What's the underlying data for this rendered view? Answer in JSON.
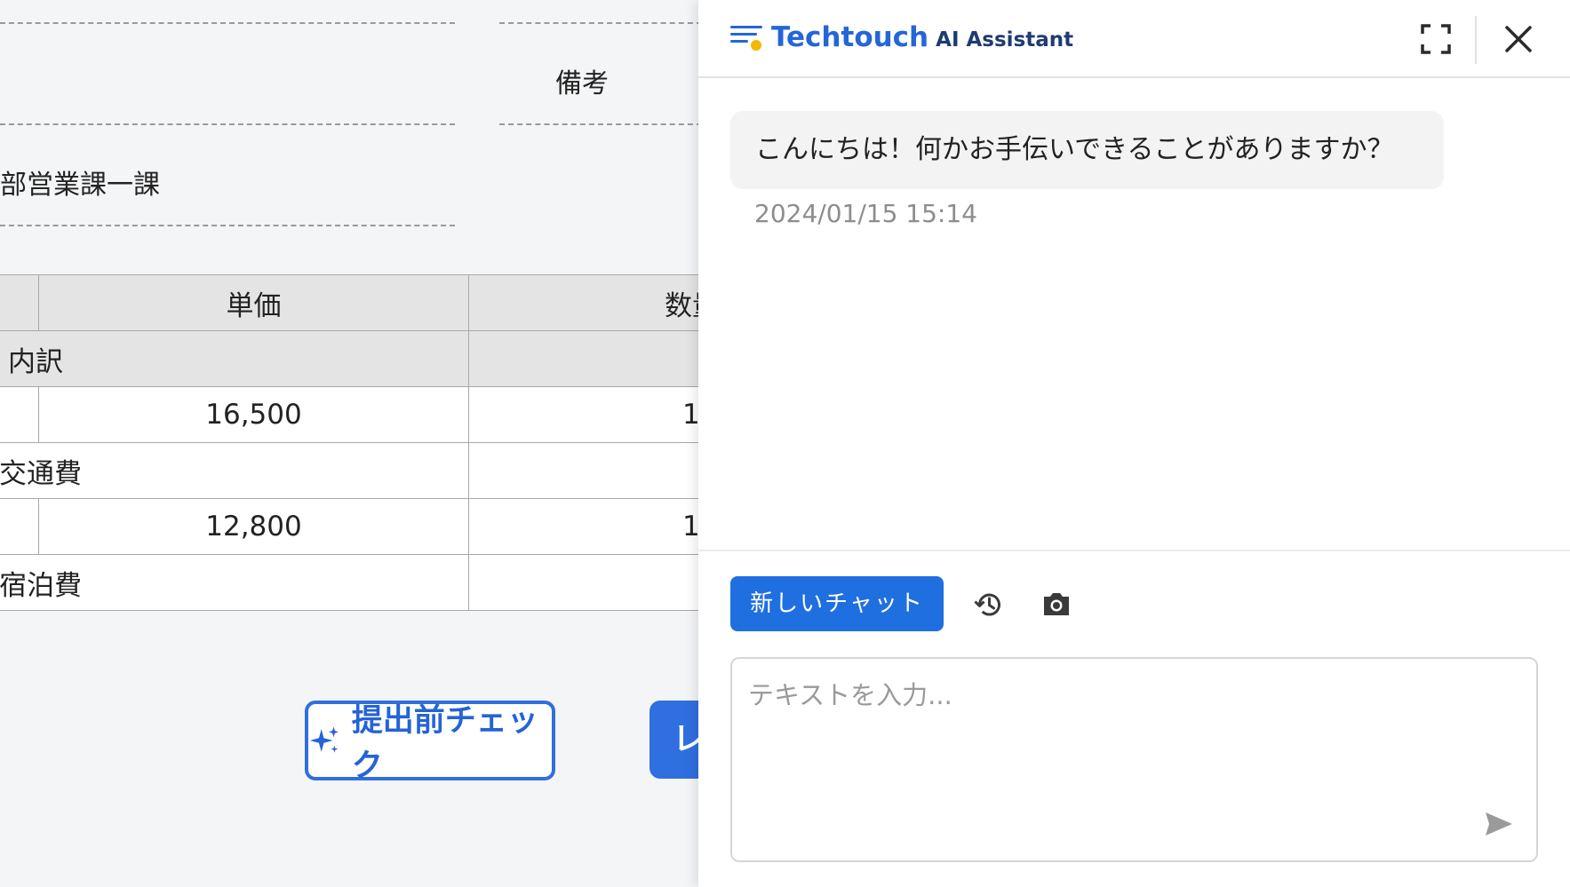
{
  "background_form": {
    "remarks_label": "備考",
    "department_value": "部営業課一課",
    "table": {
      "header": {
        "unit_price": "単価",
        "quantity": "数量"
      },
      "rows": [
        {
          "kind": "section",
          "label": "内訳"
        },
        {
          "kind": "item",
          "unit_price": "16,500",
          "quantity": "1"
        },
        {
          "kind": "section",
          "label": "交通費"
        },
        {
          "kind": "item",
          "unit_price": "12,800",
          "quantity": "1"
        },
        {
          "kind": "section",
          "label": "宿泊費"
        }
      ]
    },
    "precheck_button": {
      "label": "提出前チェック",
      "icon": "sparkle-icon"
    },
    "next_button": {
      "label": "レ"
    }
  },
  "assistant": {
    "brand": "Techtouch",
    "product": "AI Assistant",
    "header_icons": [
      "expand-icon",
      "close-icon"
    ],
    "messages": [
      {
        "text": "こんにちは！何かお手伝いできることがありますか？",
        "time": "2024/01/15 15:14"
      }
    ],
    "new_chat_label": "新しいチャット",
    "toolbar_icons": [
      "history-icon",
      "camera-icon"
    ],
    "input": {
      "placeholder": "テキストを入力...",
      "value": ""
    },
    "send_icon": "send-icon",
    "colors": {
      "primary": "#1f6fe0",
      "brand_blue": "#2466d8",
      "accent_yellow": "#f5b800"
    }
  }
}
